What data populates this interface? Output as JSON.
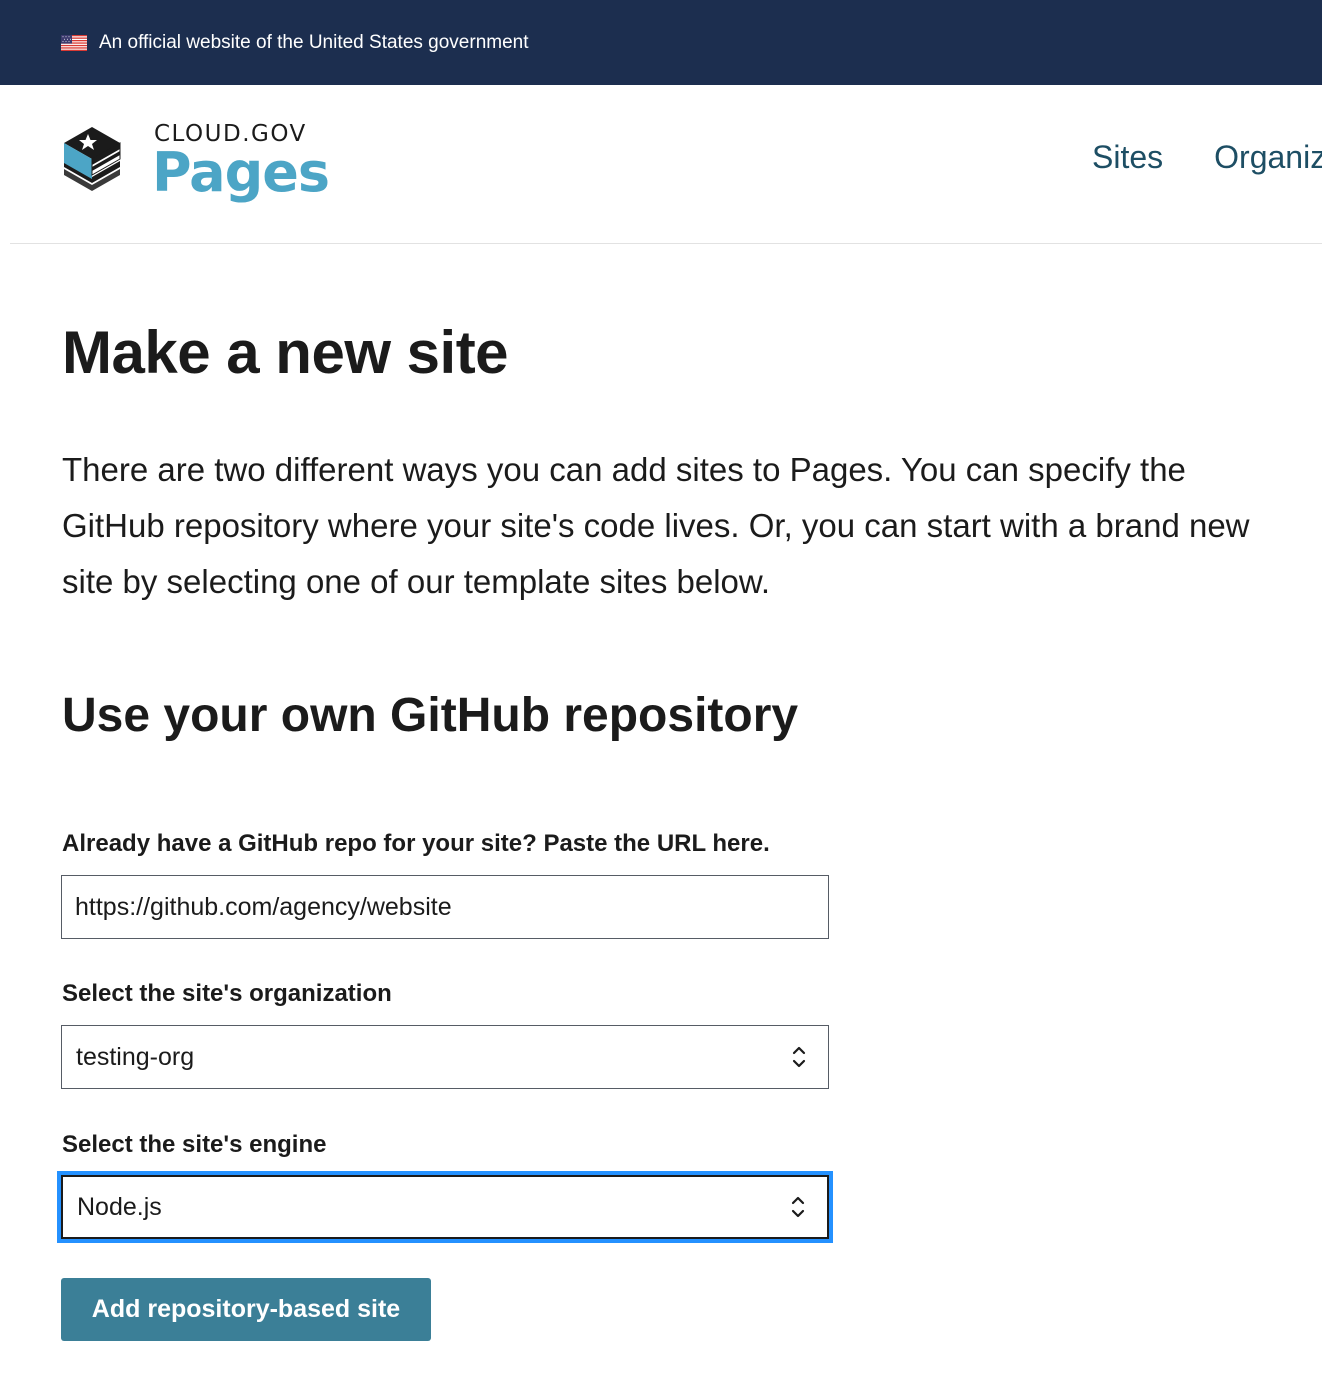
{
  "gov_banner": {
    "text": "An official website of the United States government"
  },
  "logo": {
    "top_text": "CLOUD.GOV",
    "main_text": "Pages",
    "icon": "cloud-gov-star-book-icon"
  },
  "nav": {
    "items": [
      {
        "label": "Sites"
      },
      {
        "label": "Organiz"
      }
    ]
  },
  "main": {
    "title": "Make a new site",
    "intro": "There are two different ways you can add sites to Pages. You can specify the GitHub repository where your site's code lives. Or, you can start with a brand new site by selecting one of our template sites below.",
    "section_title": "Use your own GitHub repository"
  },
  "form": {
    "repo_label": "Already have a GitHub repo for your site? Paste the URL here.",
    "repo_value": "https://github.com/agency/website",
    "org_label": "Select the site's organization",
    "org_value": "testing-org",
    "engine_label": "Select the site's engine",
    "engine_value": "Node.js",
    "submit_label": "Add repository-based site"
  },
  "colors": {
    "banner_bg": "#1c2e4f",
    "brand_blue": "#4ca5c6",
    "nav_link": "#1d4e64",
    "button_bg": "#3b7f97",
    "focus_ring": "#2491ff"
  }
}
